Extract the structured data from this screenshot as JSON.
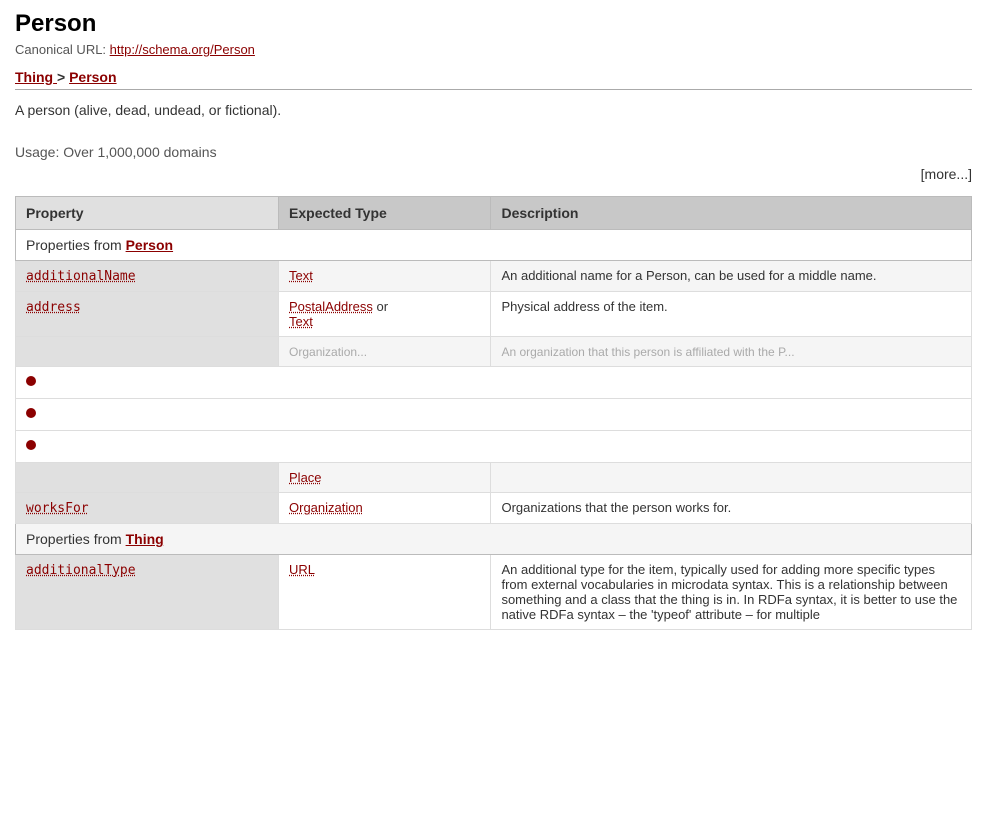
{
  "page": {
    "title": "Person",
    "canonical_label": "Canonical URL:",
    "canonical_url": "http://schema.org/Person",
    "canonical_url_text": "http://schema.org/Person",
    "breadcrumb": {
      "parent": "Thing",
      "current": "Person",
      "separator": " > "
    },
    "description": "A person (alive, dead, undead, or fictional).",
    "usage": "Usage: Over 1,000,000 domains",
    "more_link": "[more...]"
  },
  "table": {
    "headers": {
      "property": "Property",
      "expected_type": "Expected Type",
      "description": "Description"
    },
    "sections": [
      {
        "section_label": "Properties from ",
        "section_link_text": "Person",
        "rows": [
          {
            "property": "additionalName",
            "types": [
              "Text"
            ],
            "description": "An additional name for a Person, can be used for a middle name."
          },
          {
            "property": "address",
            "types": [
              "PostalAddress",
              "or",
              "Text"
            ],
            "description": "Physical address of the item."
          },
          {
            "property": "...",
            "types": [
              "..."
            ],
            "description": "An organization that this person is affiliated with. For..."
          }
        ]
      }
    ],
    "dots": [
      "•",
      "•",
      "•"
    ],
    "worksFor_row": {
      "property": "worksFor",
      "type": "Organization",
      "description": "Organizations that the person works for."
    },
    "section2": {
      "section_label": "Properties from ",
      "section_link_text": "Thing"
    },
    "additionalType_row": {
      "property": "additionalType",
      "type": "URL",
      "description": "An additional type for the item, typically used for adding more specific types from external vocabularies in microdata syntax. This is a relationship between something and a class that the thing is in. In RDFa syntax, it is better to use the native RDFa syntax – the 'typeof' attribute – for multiple"
    }
  }
}
